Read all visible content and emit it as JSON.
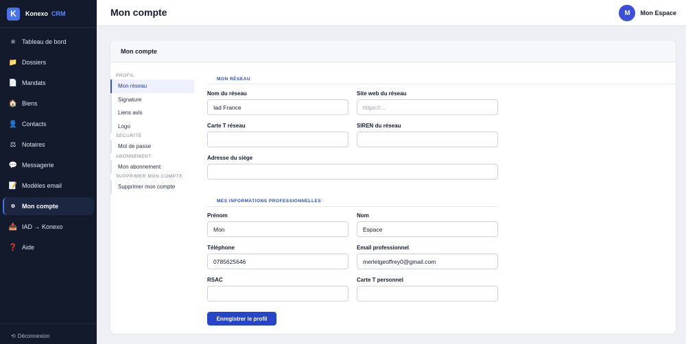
{
  "brand": {
    "logo_letter": "K",
    "name": "Konexo",
    "suffix": "CRM"
  },
  "sidebar": {
    "items": [
      {
        "label": "Tableau de bord",
        "icon": "⊞"
      },
      {
        "label": "Dossiers",
        "icon": "📁"
      },
      {
        "label": "Mandats",
        "icon": "📄"
      },
      {
        "label": "Biens",
        "icon": "🏠"
      },
      {
        "label": "Contacts",
        "icon": "👤"
      },
      {
        "label": "Notaires",
        "icon": "⚖"
      },
      {
        "label": "Messagerie",
        "icon": "💬"
      },
      {
        "label": "Modèles email",
        "icon": "📝"
      },
      {
        "label": "Mon compte",
        "icon": "⚙",
        "active": true
      },
      {
        "label": "IAD → Konexo",
        "icon": "📥"
      },
      {
        "label": "Aide",
        "icon": "❓"
      }
    ],
    "logout_icon": "⟲",
    "logout_label": "Déconnexion"
  },
  "header": {
    "title": "Mon compte",
    "avatar_letter": "M",
    "user_name": "Mon Espace"
  },
  "card": {
    "title": "Mon compte"
  },
  "subnav": {
    "groups": [
      {
        "label": "PROFIL",
        "items": [
          "Mon réseau",
          "Signature",
          "Liens avis",
          "Logo"
        ]
      },
      {
        "label": "SÉCURITÉ",
        "items": [
          "Mot de passe"
        ]
      },
      {
        "label": "ABONNEMENT",
        "items": [
          "Mon abonnement"
        ]
      },
      {
        "label": "SUPPRIMER MON COMPTE",
        "items": [
          "Supprimer mon compte"
        ]
      }
    ],
    "active_item": "Mon réseau"
  },
  "form": {
    "network_section": "MON RÉSEAU",
    "network_name": {
      "label": "Nom du réseau",
      "value": "Iad France"
    },
    "network_website": {
      "label": "Site web du réseau",
      "placeholder": "https://..."
    },
    "carte_t_network": {
      "label": "Carte T réseau",
      "value": ""
    },
    "siren": {
      "label": "SIREN du réseau",
      "value": ""
    },
    "hq_address": {
      "label": "Adresse du siège",
      "value": ""
    },
    "pro_section": "MES INFORMATIONS PROFESSIONNELLES",
    "first_name": {
      "label": "Prénom",
      "value": "Mon"
    },
    "last_name": {
      "label": "Nom",
      "value": "Espace"
    },
    "phone": {
      "label": "Téléphone",
      "value": "0785625646"
    },
    "email": {
      "label": "Email professionnel",
      "value": "merletgeoffrey0@gmail.com"
    },
    "rsac": {
      "label": "RSAC",
      "value": ""
    },
    "carte_t_personal": {
      "label": "Carte T personnel",
      "value": ""
    },
    "save_label": "Enregistrer le profil"
  },
  "colors": {
    "sidebar_bg": "#131a2b",
    "accent": "#2746c7",
    "avatar": "#3b4fd8"
  }
}
